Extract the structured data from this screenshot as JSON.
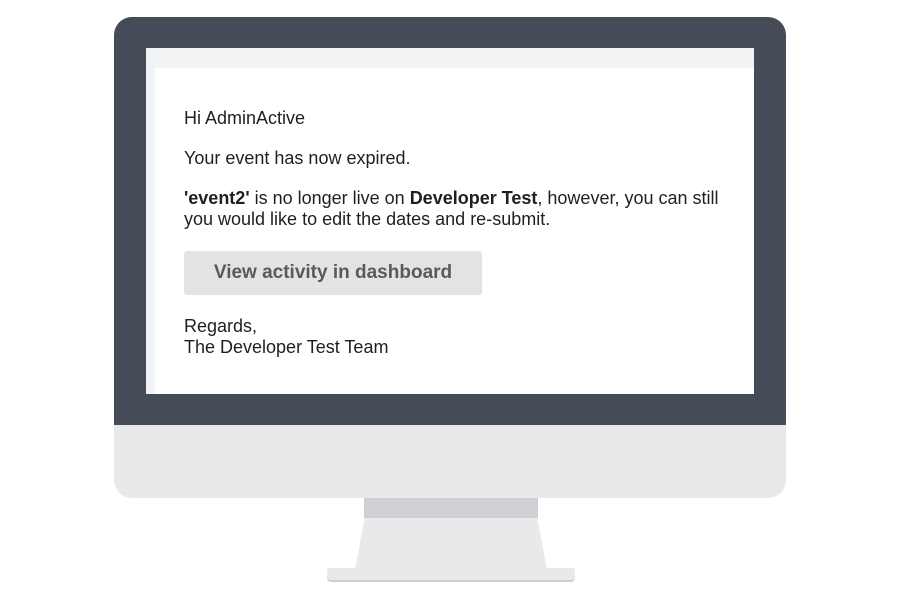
{
  "email": {
    "greeting": "Hi AdminActive",
    "expired_text": "Your event has now expired.",
    "details": {
      "event_name": "'event2'",
      "middle_text": " is no longer live on ",
      "site_name": "Developer Test",
      "line1_rest": ", however, you can still",
      "line2": "you would like to edit the dates and re-submit."
    },
    "cta_label": "View activity in dashboard",
    "signoff_line1": "Regards,",
    "signoff_line2": "The Developer Test Team"
  },
  "colors": {
    "bezel": "#464b58",
    "chin": "#e8e9eb",
    "button_bg": "#e3e3e3",
    "button_text": "#5a5a5a"
  }
}
